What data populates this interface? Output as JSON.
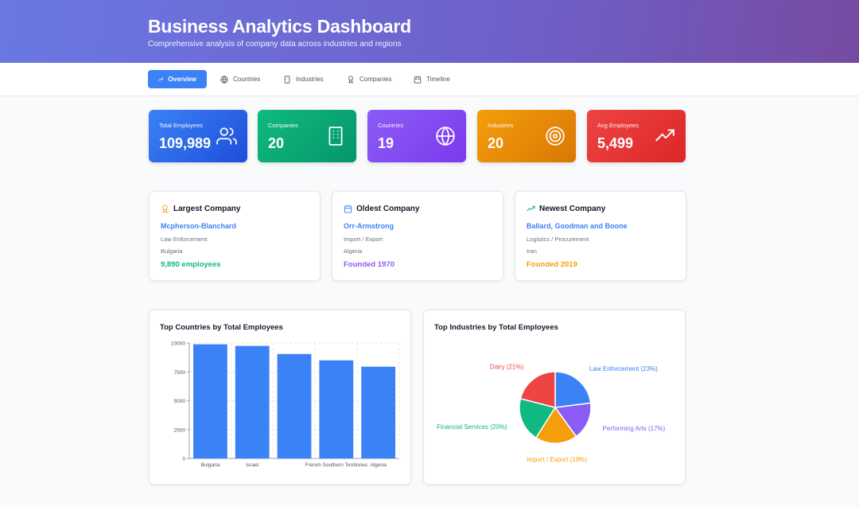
{
  "header": {
    "title": "Business Analytics Dashboard",
    "subtitle": "Comprehensive analysis of company data across industries and regions"
  },
  "tabs": [
    {
      "label": "Overview",
      "icon": "trending-up-icon",
      "active": true
    },
    {
      "label": "Countries",
      "icon": "globe-icon",
      "active": false
    },
    {
      "label": "Industries",
      "icon": "building-icon",
      "active": false
    },
    {
      "label": "Companies",
      "icon": "award-icon",
      "active": false
    },
    {
      "label": "Timeline",
      "icon": "calendar-icon",
      "active": false
    }
  ],
  "stats": [
    {
      "label": "Total Employees",
      "value": "109,989",
      "icon": "users-icon",
      "color": "#2f6fe8"
    },
    {
      "label": "Companies",
      "value": "20",
      "icon": "building-icon",
      "color": "#10a574"
    },
    {
      "label": "Countries",
      "value": "19",
      "icon": "globe-icon",
      "color": "#8b55f0"
    },
    {
      "label": "Industries",
      "value": "20",
      "icon": "target-icon",
      "color": "#ee8c0b"
    },
    {
      "label": "Avg Employees",
      "value": "5,499",
      "icon": "trending-up-icon",
      "color": "#ea3a3a"
    }
  ],
  "highlights": [
    {
      "title": "Largest Company",
      "icon": "award-icon",
      "name": "Mcpherson-Blanchard",
      "line1": "Law Enforcement",
      "line2": "Bulgaria",
      "footer": "9,890 employees",
      "footer_color": "#10b981",
      "icon_color": "#f59e0b"
    },
    {
      "title": "Oldest Company",
      "icon": "calendar-icon",
      "name": "Orr-Armstrong",
      "line1": "Import / Export",
      "line2": "Algeria",
      "footer": "Founded 1970",
      "footer_color": "#8b5cf6",
      "icon_color": "#3b82f6"
    },
    {
      "title": "Newest Company",
      "icon": "trending-up-icon",
      "name": "Ballard, Goodman and Boone",
      "line1": "Logistics / Procurement",
      "line2": "Iran",
      "footer": "Founded 2019",
      "footer_color": "#f59e0b",
      "icon_color": "#10b981"
    }
  ],
  "chart_data": [
    {
      "type": "bar",
      "title": "Top Countries by Total Employees",
      "categories": [
        "Bulgaria",
        "Israel",
        "",
        "French Southern Territories",
        "Algeria"
      ],
      "values": [
        9890,
        9750,
        9050,
        8500,
        7950
      ],
      "ylim": [
        0,
        10000
      ],
      "yticks": [
        0,
        2500,
        5000,
        7500,
        10000
      ],
      "color": "#3b82f6",
      "grid": true
    },
    {
      "type": "pie",
      "title": "Top Industries by Total Employees",
      "slices": [
        {
          "label": "Law Enforcement (23%)",
          "value": 23,
          "color": "#3b82f6"
        },
        {
          "label": "Performing Arts (17%)",
          "value": 17,
          "color": "#8b5cf6"
        },
        {
          "label": "Import / Export (19%)",
          "value": 19,
          "color": "#f59e0b"
        },
        {
          "label": "Financial Services (20%)",
          "value": 20,
          "color": "#10b981"
        },
        {
          "label": "Dairy (21%)",
          "value": 21,
          "color": "#ef4444"
        }
      ]
    }
  ]
}
